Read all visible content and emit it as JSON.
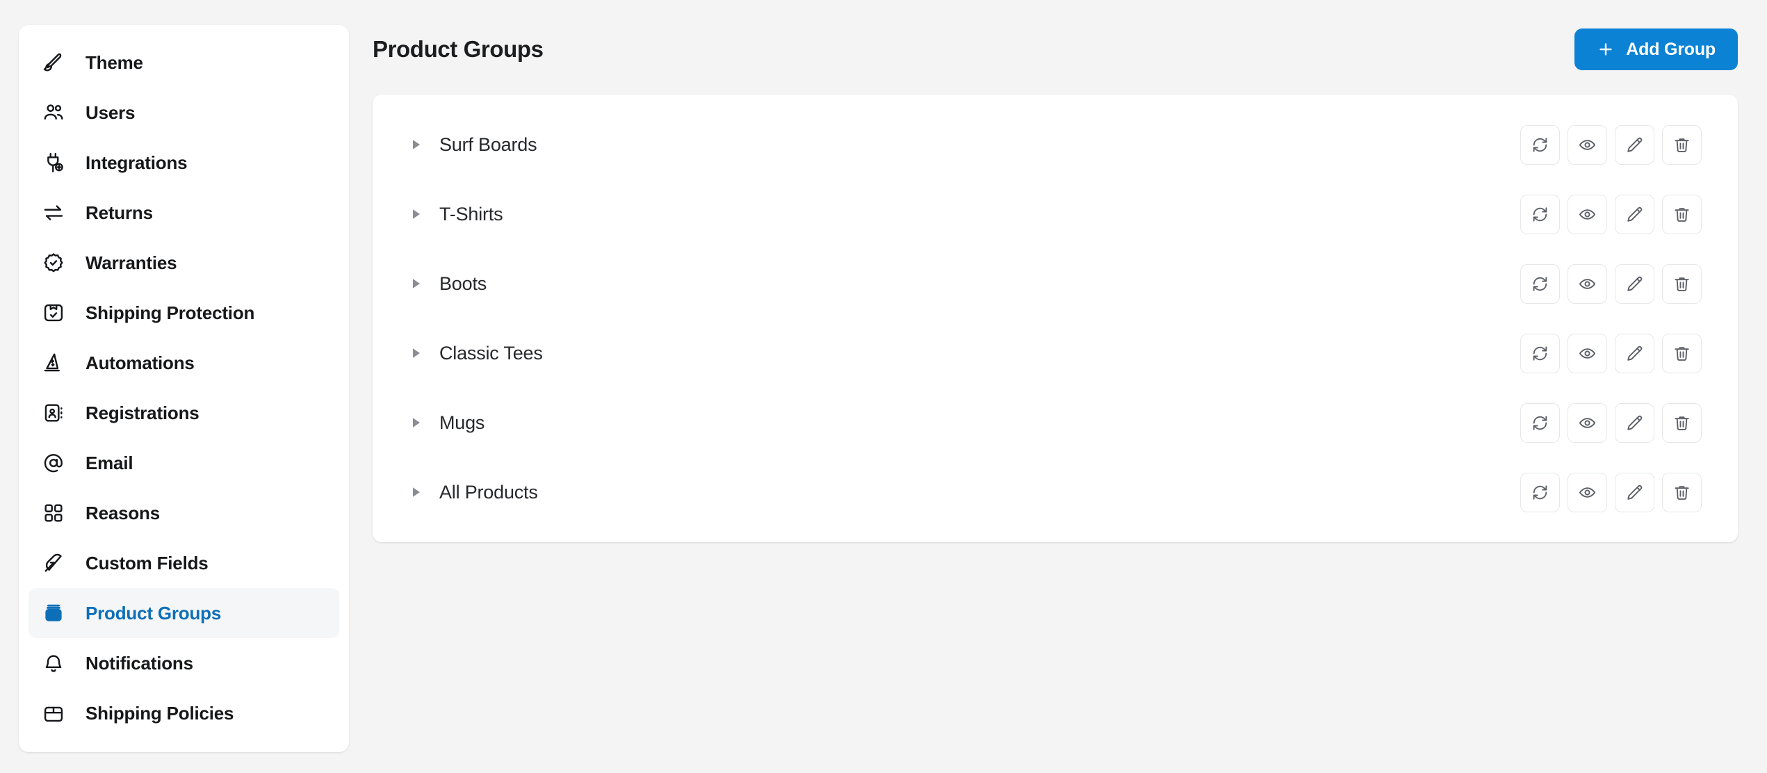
{
  "colors": {
    "page_bg": "#f4f4f4",
    "panel_bg": "#ffffff",
    "accent_blue": "#0b82d4",
    "sidebar_active_blue": "#0d6fb8",
    "sidebar_active_bg": "#f5f6f7",
    "text_primary": "#17181a",
    "icon_muted": "#5c5f66"
  },
  "sidebar": {
    "items": [
      {
        "label": "Theme",
        "icon": "brush-icon",
        "active": false
      },
      {
        "label": "Users",
        "icon": "users-icon",
        "active": false
      },
      {
        "label": "Integrations",
        "icon": "plug-plus-icon",
        "active": false
      },
      {
        "label": "Returns",
        "icon": "arrows-exchange-icon",
        "active": false
      },
      {
        "label": "Warranties",
        "icon": "badge-check-icon",
        "active": false
      },
      {
        "label": "Shipping Protection",
        "icon": "package-check-icon",
        "active": false
      },
      {
        "label": "Automations",
        "icon": "wizard-hat-icon",
        "active": false
      },
      {
        "label": "Registrations",
        "icon": "id-card-icon",
        "active": false
      },
      {
        "label": "Email",
        "icon": "at-sign-icon",
        "active": false
      },
      {
        "label": "Reasons",
        "icon": "grid-squares-icon",
        "active": false
      },
      {
        "label": "Custom Fields",
        "icon": "feather-icon",
        "active": false
      },
      {
        "label": "Product Groups",
        "icon": "product-jar-icon",
        "active": true
      },
      {
        "label": "Notifications",
        "icon": "bell-icon",
        "active": false
      },
      {
        "label": "Shipping Policies",
        "icon": "box-icon",
        "active": false
      }
    ]
  },
  "header": {
    "title": "Product Groups",
    "add_button": {
      "label": "Add Group",
      "icon": "plus-icon"
    }
  },
  "main": {
    "row_actions": [
      {
        "name": "sync",
        "icon": "refresh-icon",
        "title": "Sync"
      },
      {
        "name": "view",
        "icon": "eye-icon",
        "title": "View"
      },
      {
        "name": "edit",
        "icon": "pencil-icon",
        "title": "Edit"
      },
      {
        "name": "delete",
        "icon": "trash-icon",
        "title": "Delete"
      }
    ],
    "groups": [
      {
        "name": "Surf Boards",
        "expanded": false,
        "caret": "caret-right-icon"
      },
      {
        "name": "T-Shirts",
        "expanded": false,
        "caret": "caret-right-icon"
      },
      {
        "name": "Boots",
        "expanded": false,
        "caret": "caret-right-icon"
      },
      {
        "name": "Classic Tees",
        "expanded": false,
        "caret": "caret-right-icon"
      },
      {
        "name": "Mugs",
        "expanded": false,
        "caret": "caret-right-icon"
      },
      {
        "name": "All Products",
        "expanded": false,
        "caret": "caret-right-icon"
      }
    ]
  }
}
